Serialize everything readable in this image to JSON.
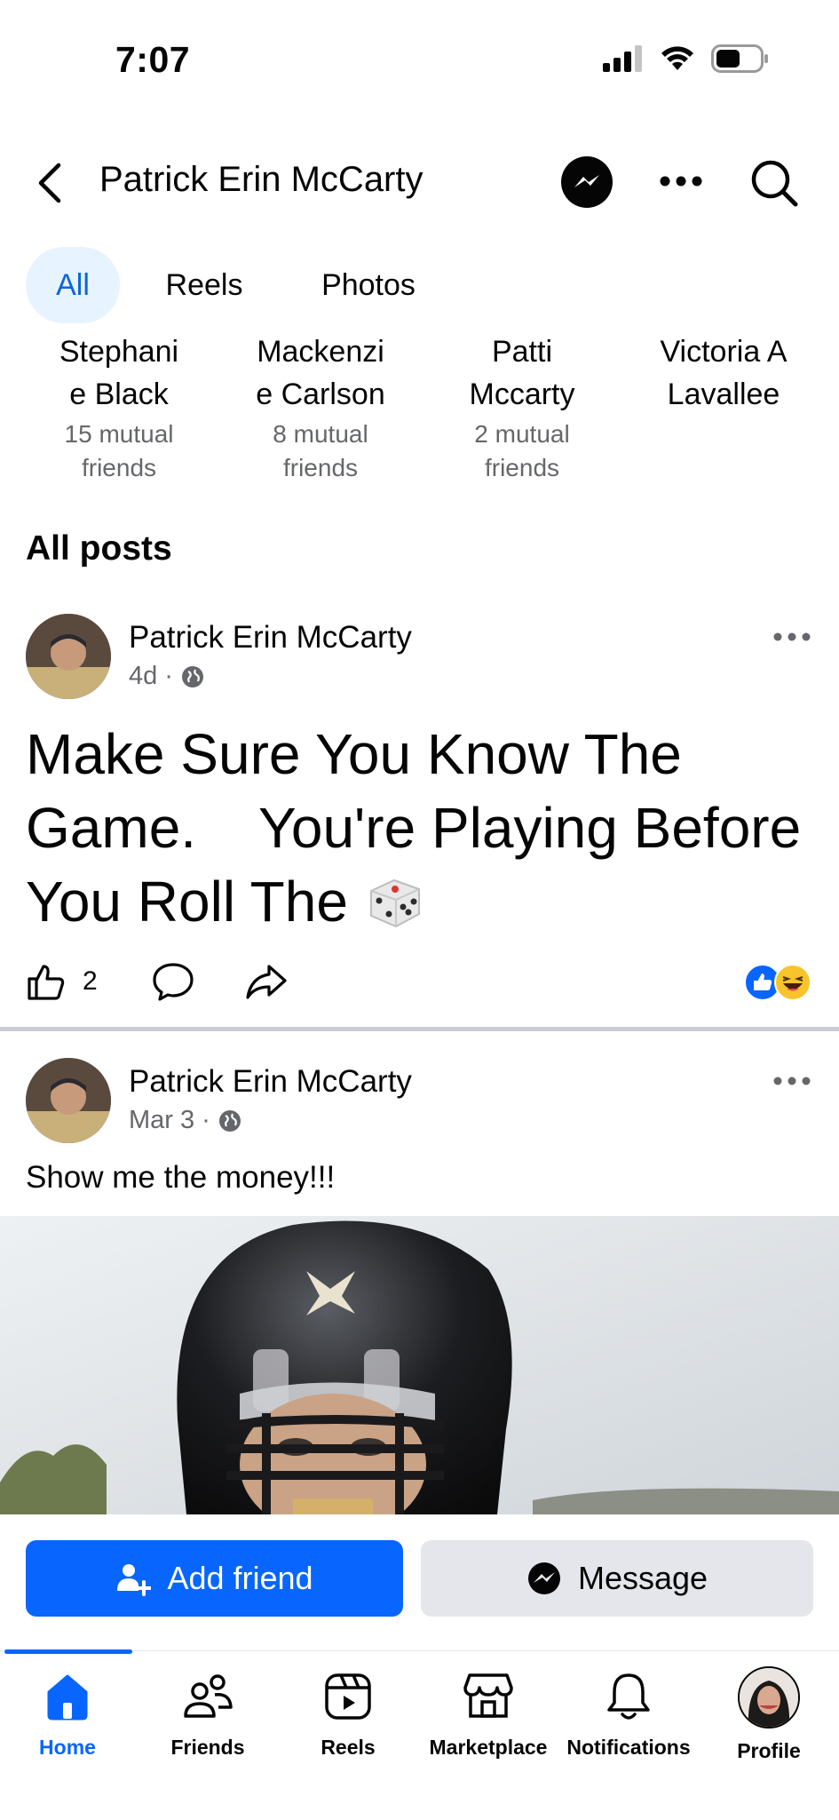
{
  "status_bar": {
    "time": "7:07"
  },
  "header": {
    "title": "Patrick Erin McCarty"
  },
  "tabs": [
    {
      "label": "All"
    },
    {
      "label": "Reels"
    },
    {
      "label": "Photos"
    }
  ],
  "mutual_friends": [
    {
      "name_line1": "Stephani",
      "name_line2": "e Black",
      "mutual_line1": "15 mutual",
      "mutual_line2": "friends"
    },
    {
      "name_line1": "Mackenzi",
      "name_line2": "e Carlson",
      "mutual_line1": "8 mutual",
      "mutual_line2": "friends"
    },
    {
      "name_line1": "Patti",
      "name_line2": "Mccarty",
      "mutual_line1": "2 mutual",
      "mutual_line2": "friends"
    },
    {
      "name_line1": "Victoria A",
      "name_line2": "Lavallee",
      "mutual_line1": "",
      "mutual_line2": ""
    }
  ],
  "section_title": "All posts",
  "posts": [
    {
      "author": "Patrick Erin McCarty",
      "time": "4d",
      "text_line1": "Make Sure You Know The",
      "text_line2": "Game.    You're Playing Before",
      "text_line3": "You Roll The",
      "like_count": "2"
    },
    {
      "author": "Patrick Erin McCarty",
      "time": "Mar 3",
      "caption": "Show me the money!!!"
    }
  ],
  "actions": {
    "add_friend": "Add friend",
    "message": "Message"
  },
  "nav": [
    {
      "label": "Home",
      "icon": "home-icon"
    },
    {
      "label": "Friends",
      "icon": "friends-icon"
    },
    {
      "label": "Reels",
      "icon": "reels-icon"
    },
    {
      "label": "Marketplace",
      "icon": "marketplace-icon"
    },
    {
      "label": "Notifications",
      "icon": "bell-icon"
    },
    {
      "label": "Profile",
      "icon": "profile-avatar"
    }
  ],
  "colors": {
    "accent": "#0866ff",
    "tab_active_bg": "#e7f3ff",
    "secondary_text": "#65676b"
  }
}
